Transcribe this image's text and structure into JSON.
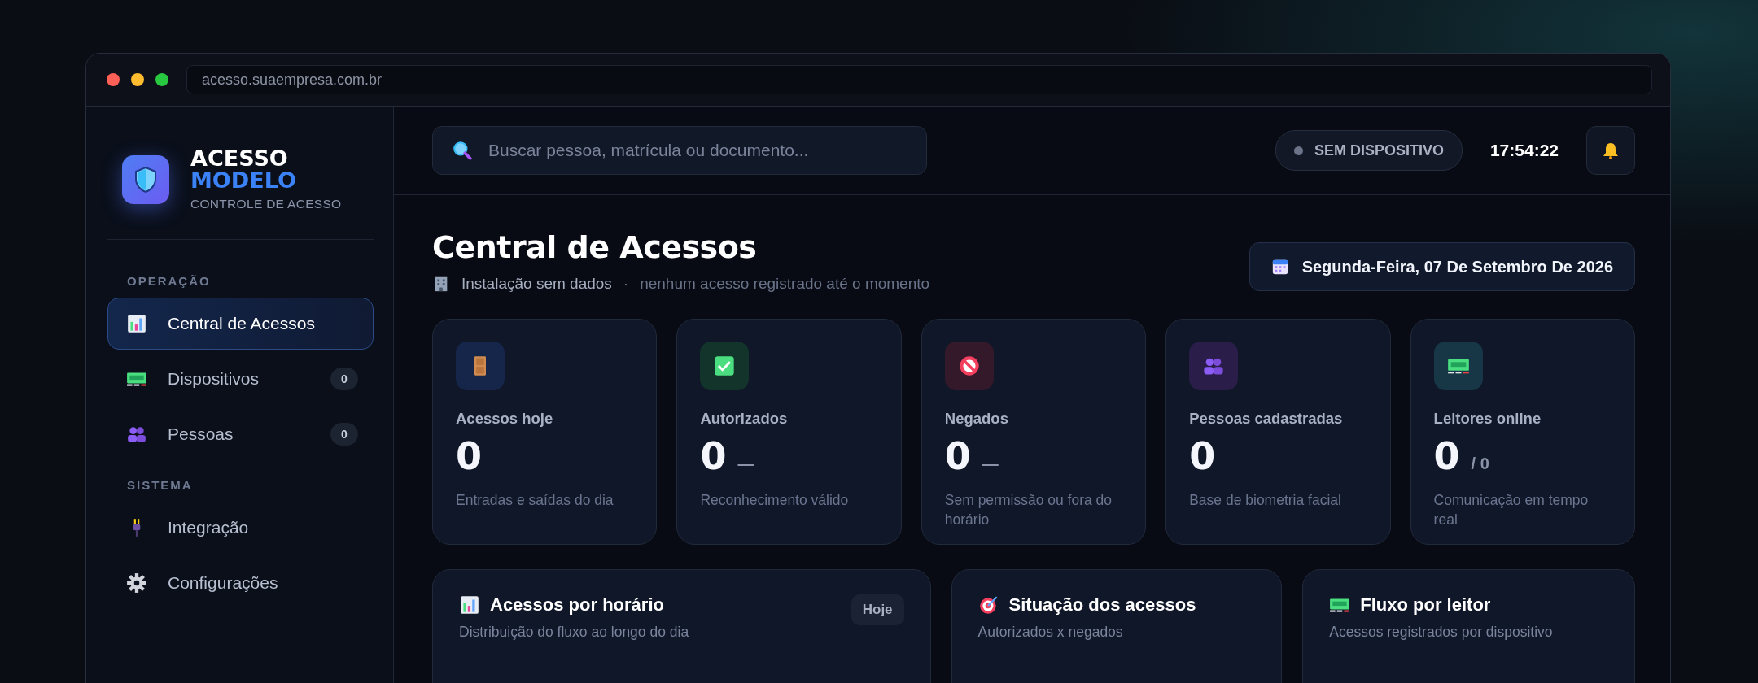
{
  "browser": {
    "url": "acesso.suaempresa.com.br"
  },
  "brand": {
    "line1": "ACESSO",
    "line2": "MODELO",
    "tagline": "CONTROLE DE ACESSO"
  },
  "sidebar": {
    "sections": [
      {
        "title": "OPERAÇÃO",
        "items": [
          {
            "label": "Central de Acessos",
            "kind": "chart",
            "selected": true
          },
          {
            "label": "Dispositivos",
            "kind": "reader",
            "count": "0",
            "selected": false
          },
          {
            "label": "Pessoas",
            "kind": "people",
            "count": "0",
            "selected": false
          }
        ]
      },
      {
        "title": "SISTEMA",
        "items": [
          {
            "label": "Integração",
            "kind": "plug",
            "selected": false
          },
          {
            "label": "Configurações",
            "kind": "gear",
            "selected": false
          }
        ]
      }
    ]
  },
  "topbar": {
    "search": {
      "placeholder": "Buscar pessoa, matrícula ou documento..."
    },
    "status": "SEM DISPOSITIVO",
    "clock": "17:54:22"
  },
  "header": {
    "title": "Central de Acessos",
    "subtitle": "Instalação sem dados",
    "separator": "·",
    "note": "nenhum acesso registrado até o momento",
    "date": "Segunda-Feira, 07 De Setembro De 2026"
  },
  "stats": [
    {
      "kind": "door",
      "color": "#15264a",
      "label": "Acessos hoje",
      "value": "0",
      "description": "Entradas e saídas do dia"
    },
    {
      "kind": "check",
      "color": "#12342a",
      "label": "Autorizados",
      "value": "0",
      "suffix": "—",
      "description": "Reconhecimento válido"
    },
    {
      "kind": "forbidden",
      "color": "#33192a",
      "label": "Negados",
      "value": "0",
      "suffix": "—",
      "description": "Sem permissão ou fora do horário"
    },
    {
      "kind": "people",
      "color": "#2a1d4a",
      "label": "Pessoas cadastradas",
      "value": "0",
      "description": "Base de biometria facial"
    },
    {
      "kind": "reader",
      "color": "#173646",
      "label": "Leitores online",
      "value": "0",
      "suffix": "/ 0",
      "description": "Comunicação em tempo real"
    }
  ],
  "panels": [
    {
      "kind": "chart",
      "title": "Acessos por horário",
      "subtitle": "Distribuição do fluxo ao longo do dia",
      "badge": "Hoje"
    },
    {
      "kind": "target",
      "title": "Situação dos acessos",
      "subtitle": "Autorizados x negados"
    },
    {
      "kind": "reader",
      "title": "Fluxo por leitor",
      "subtitle": "Acessos registrados por dispositivo"
    }
  ]
}
